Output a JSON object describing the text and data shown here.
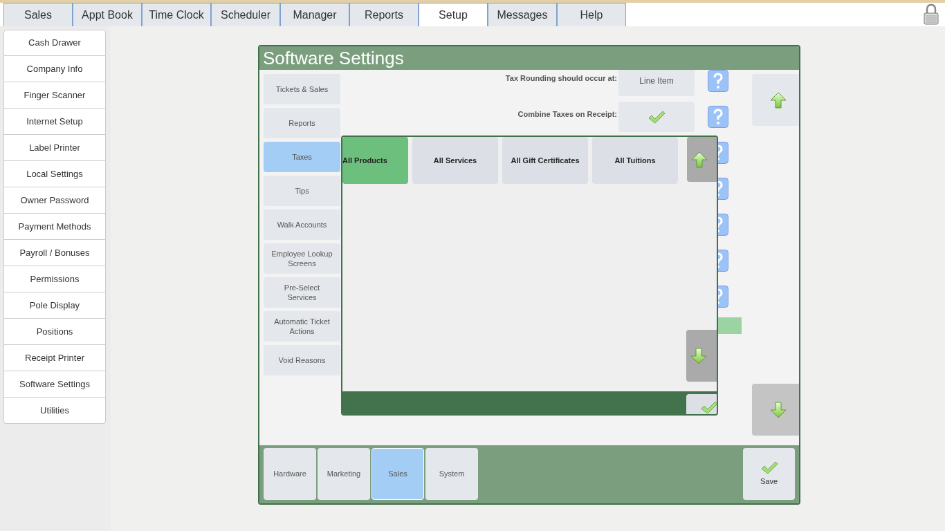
{
  "top_tabs": [
    {
      "label": "Sales",
      "selected": false
    },
    {
      "label": "Appt Book",
      "selected": false
    },
    {
      "label": "Time Clock",
      "selected": false
    },
    {
      "label": "Scheduler",
      "selected": false
    },
    {
      "label": "Manager",
      "selected": false
    },
    {
      "label": "Reports",
      "selected": false
    },
    {
      "label": "Setup",
      "selected": true
    },
    {
      "label": "Messages",
      "selected": false
    },
    {
      "label": "Help",
      "selected": false
    }
  ],
  "sidebar": {
    "items": [
      "Cash Drawer",
      "Company Info",
      "Finger Scanner",
      "Internet Setup",
      "Label Printer",
      "Local Settings",
      "Owner Password",
      "Payment Methods",
      "Payroll / Bonuses",
      "Permissions",
      "Pole Display",
      "Positions",
      "Receipt Printer",
      "Software Settings",
      "Utilities"
    ]
  },
  "panel": {
    "title": "Software Settings",
    "categories": [
      {
        "label": "Tickets & Sales",
        "selected": false
      },
      {
        "label": "Reports",
        "selected": false
      },
      {
        "label": "Taxes",
        "selected": true
      },
      {
        "label": "Tips",
        "selected": false
      },
      {
        "label": "Walk Accounts",
        "selected": false
      },
      {
        "label": "Employee Lookup Screens",
        "selected": false
      },
      {
        "label": "Pre-Select Services",
        "selected": false
      },
      {
        "label": "Automatic Ticket Actions",
        "selected": false
      },
      {
        "label": "Void Reasons",
        "selected": false
      }
    ],
    "settings": [
      {
        "kind": "text",
        "label": "Tax Rounding should occur at:",
        "value": "Line Item"
      },
      {
        "kind": "check",
        "label": "Combine Taxes on Receipt:",
        "checked": true
      },
      {
        "kind": "covered"
      },
      {
        "kind": "covered"
      },
      {
        "kind": "covered"
      },
      {
        "kind": "covered"
      },
      {
        "kind": "covered"
      },
      {
        "kind": "bar"
      }
    ]
  },
  "popup": {
    "tabs": [
      {
        "label": "All Products",
        "selected": true
      },
      {
        "label": "All Services",
        "selected": false
      },
      {
        "label": "All Gift Certificates",
        "selected": false
      },
      {
        "label": "All Tuitions",
        "selected": false
      }
    ]
  },
  "sections": [
    {
      "label": "Hardware",
      "selected": false
    },
    {
      "label": "Marketing",
      "selected": false
    },
    {
      "label": "Sales",
      "selected": true
    },
    {
      "label": "System",
      "selected": false
    }
  ],
  "save": {
    "label": "Save"
  }
}
